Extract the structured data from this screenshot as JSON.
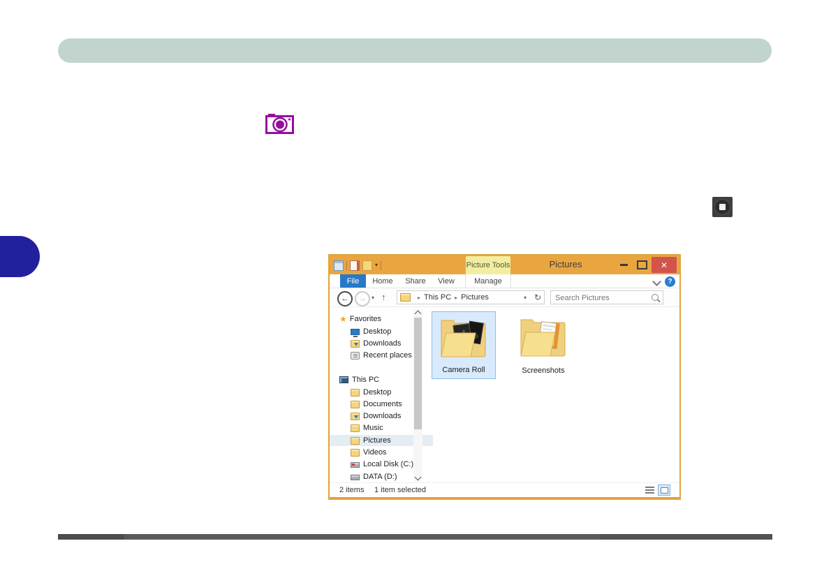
{
  "colors": {
    "header_pill": "#c1d5ce",
    "chapter_tab": "#23209d",
    "footer_bar": "#5a5a5a",
    "camera_icon_purple": "#970e9c",
    "titlebar_orange": "#e9a640",
    "close_button_red": "#d2544c",
    "file_tab_blue": "#2878c8",
    "help_icon_blue": "#2b7cd3",
    "picture_tools_highlight": "#f1eea2",
    "selection_bg": "#d9eafc",
    "selection_border": "#90bde8"
  },
  "glyphs": {
    "star": "★",
    "back_arrow": "←",
    "forward_arrow": "→",
    "up_arrow": "↑",
    "refresh": "↻",
    "caret_down": "▾",
    "breadcrumb_separator": "▸",
    "close": "✕",
    "help": "?"
  },
  "explorer": {
    "title_bar": {
      "contextual_tab_label": "Picture Tools",
      "title": "Pictures"
    },
    "ribbon": {
      "tabs": [
        {
          "label": "File",
          "active": true
        },
        {
          "label": "Home"
        },
        {
          "label": "Share"
        },
        {
          "label": "View"
        },
        {
          "label": "Manage",
          "contextual": true
        }
      ]
    },
    "address_bar": {
      "breadcrumb": [
        {
          "label": "This PC"
        },
        {
          "label": "Pictures"
        }
      ],
      "search_placeholder": "Search Pictures"
    },
    "sidebar": {
      "favorites": {
        "label": "Favorites",
        "items": [
          {
            "label": "Desktop"
          },
          {
            "label": "Downloads"
          },
          {
            "label": "Recent places"
          }
        ]
      },
      "this_pc": {
        "label": "This PC",
        "items": [
          {
            "label": "Desktop"
          },
          {
            "label": "Documents"
          },
          {
            "label": "Downloads"
          },
          {
            "label": "Music"
          },
          {
            "label": "Pictures",
            "selected": true
          },
          {
            "label": "Videos"
          },
          {
            "label": "Local Disk (C:)"
          },
          {
            "label": "DATA (D:)"
          }
        ]
      }
    },
    "content": {
      "folders": [
        {
          "name": "Camera Roll",
          "selected": true
        },
        {
          "name": "Screenshots",
          "selected": false
        }
      ]
    },
    "status_bar": {
      "items_count": "2 items",
      "selection_summary": "1 item selected"
    }
  }
}
